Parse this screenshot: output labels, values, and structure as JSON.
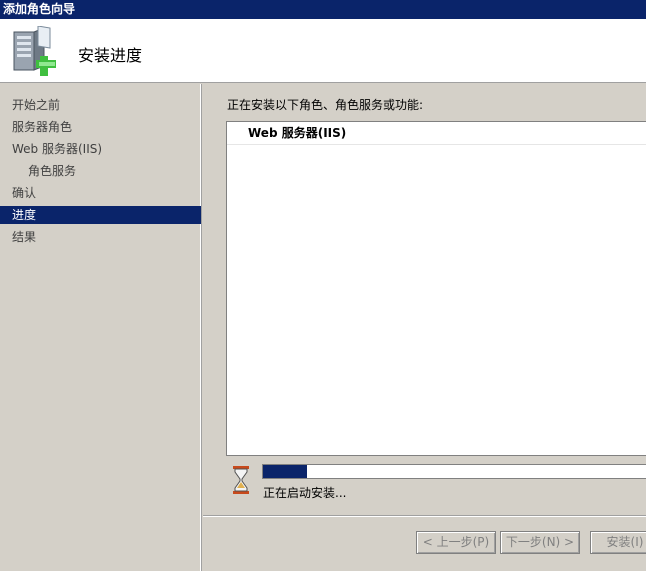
{
  "window": {
    "title": "添加角色向导"
  },
  "header": {
    "title": "安装进度",
    "icon": "server-add-icon"
  },
  "sidebar": {
    "items": [
      {
        "label": "开始之前",
        "active": false
      },
      {
        "label": "服务器角色",
        "active": false
      },
      {
        "label": "Web 服务器(IIS)",
        "active": false
      },
      {
        "label": "角色服务",
        "active": false
      },
      {
        "label": "确认",
        "active": false
      },
      {
        "label": "进度",
        "active": true
      },
      {
        "label": "结果",
        "active": false
      }
    ]
  },
  "main": {
    "label": "正在安装以下角色、角色服务或功能:",
    "list": [
      "Web 服务器(IIS)"
    ],
    "progress": {
      "percent": 11,
      "color": "#0a246a"
    },
    "status": "正在启动安装..."
  },
  "buttons": {
    "previous": "< 上一步(P)",
    "next": "下一步(N) >",
    "install": "安装(I)"
  },
  "colors": {
    "accent": "#0a246a",
    "face": "#d4d0c8"
  }
}
